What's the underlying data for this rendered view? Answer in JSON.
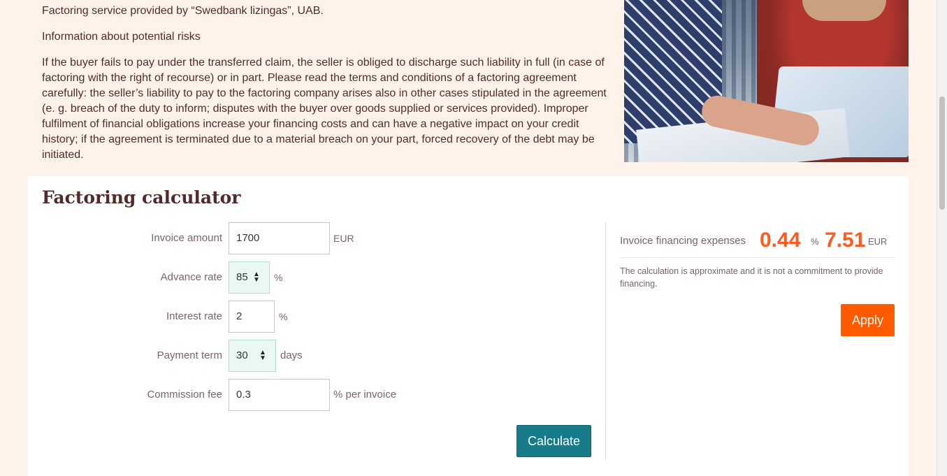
{
  "info": {
    "provider": "Factoring service provided by “Swedbank lizingas”, UAB.",
    "risks_heading": "Information about potential risks",
    "risks_text": "If the buyer fails to pay under the transferred claim, the seller is obliged to discharge such liability in full (in case of factoring with the right of recourse) or in part. Please read the terms and conditions of a factoring agreement carefully: the seller’s liability to pay to the factoring company arises also in other cases stipulated in the agreement (e. g. breach of the duty to inform; disputes with the buyer over goods supplied or services provided). Improper fulfilment of financial obligations increase your financing costs and can have a negative impact on your credit history; if the agreement is terminated due to a material breach on your part, forced recovery of the debt may be initiated."
  },
  "calculator": {
    "title": "Factoring calculator",
    "fields": {
      "invoice_amount": {
        "label": "Invoice amount",
        "value": "1700",
        "unit": "EUR"
      },
      "advance_rate": {
        "label": "Advance rate",
        "value": "85",
        "unit": "%"
      },
      "interest_rate": {
        "label": "Interest rate",
        "value": "2",
        "unit": "%"
      },
      "payment_term": {
        "label": "Payment term",
        "value": "30",
        "unit": "days"
      },
      "commission_fee": {
        "label": "Commission fee",
        "value": "0.3",
        "unit": "% per invoice"
      }
    },
    "calculate_label": "Calculate",
    "result": {
      "label": "Invoice financing expenses",
      "percent_value": "0.44",
      "percent_unit": "%",
      "amount_value": "7.51",
      "amount_unit": "EUR",
      "note": "The calculation is approximate and it is not a commitment to provide financing."
    },
    "apply_label": "Apply"
  },
  "colors": {
    "page_bg": "#fdf3ea",
    "text_primary": "#512b2b",
    "accent_orange": "#ff5a00",
    "accent_teal": "#177c88",
    "select_bg": "#e9f8f3"
  },
  "icons": {
    "spinner": "up-down-arrows-icon"
  }
}
